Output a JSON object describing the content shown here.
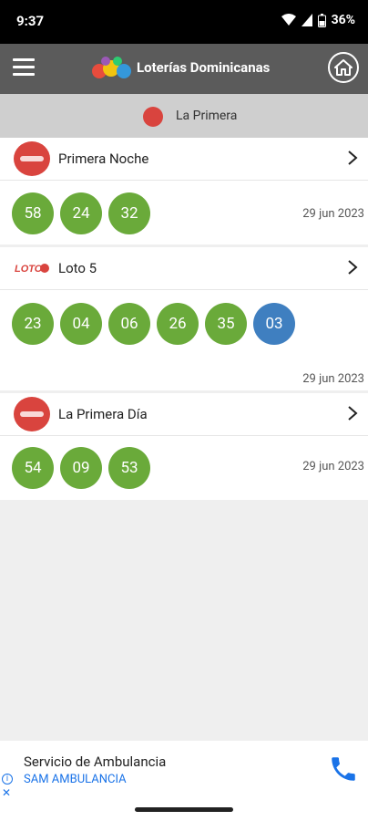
{
  "status": {
    "time": "9:37",
    "battery": "36%"
  },
  "app": {
    "title": "Loterías Dominicanas"
  },
  "subheader": {
    "title": "La Primera"
  },
  "lotteries": [
    {
      "name": "Primera Noche",
      "numbers": [
        "58",
        "24",
        "32"
      ],
      "bonus": [],
      "date": "29 jun 2023"
    },
    {
      "name": "Loto 5",
      "numbers": [
        "23",
        "04",
        "06",
        "26",
        "35"
      ],
      "bonus": [
        "03"
      ],
      "date": "29 jun 2023"
    },
    {
      "name": "La Primera Día",
      "numbers": [
        "54",
        "09",
        "53"
      ],
      "bonus": [],
      "date": "29 jun 2023"
    }
  ],
  "ad": {
    "title": "Servicio de Ambulancia",
    "advertiser": "SAM AMBULANCIA"
  },
  "colors": {
    "topbar": "#5b5b5b",
    "ball": "#6aaa3a",
    "bonus_ball": "#3f7fc0",
    "logo_red": "#d9443e"
  }
}
